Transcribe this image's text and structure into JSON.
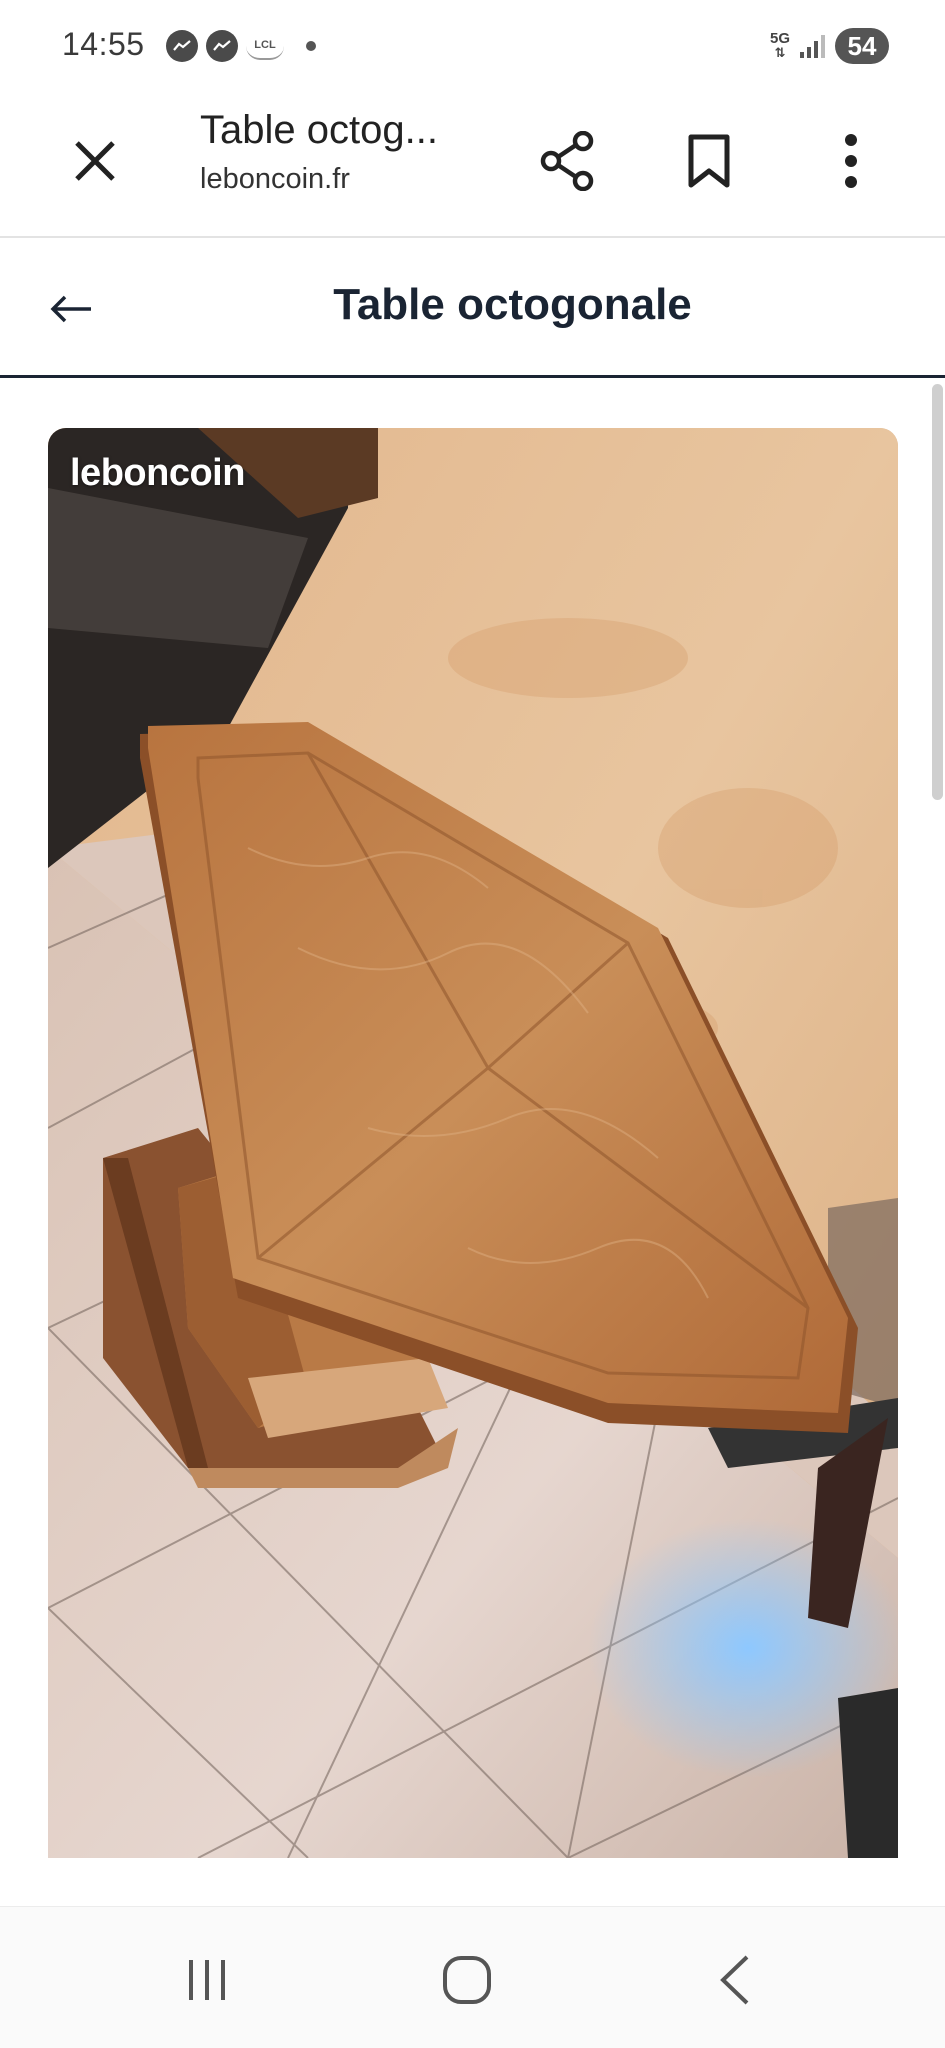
{
  "status_bar": {
    "time": "14:55",
    "lcl_label": "LCL",
    "network": "5G",
    "battery": "54"
  },
  "toolbar": {
    "title": "Table octog...",
    "url": "leboncoin.fr"
  },
  "page": {
    "title": "Table octogonale"
  },
  "photo": {
    "watermark": "leboncoin"
  },
  "icons": {
    "close": "close-icon",
    "share": "share-icon",
    "bookmark": "bookmark-icon",
    "more": "more-vertical-icon",
    "back": "arrow-left-icon",
    "nav_recent": "recent-apps-icon",
    "nav_home": "home-icon",
    "nav_back": "chevron-left-icon"
  },
  "colors": {
    "header_text": "#1a2433",
    "header_border": "#1a2433",
    "battery_badge": "#555555"
  }
}
